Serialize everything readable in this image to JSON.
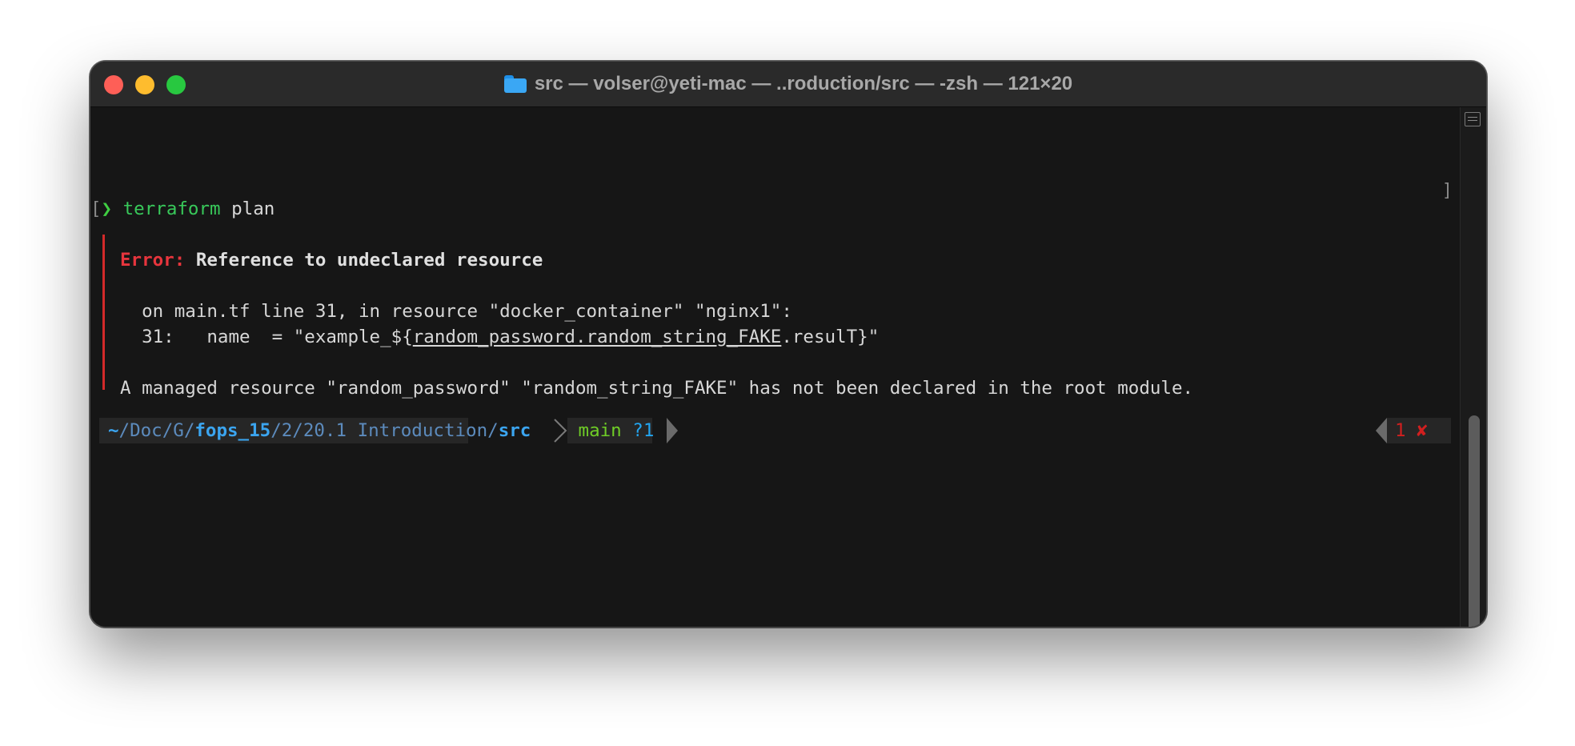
{
  "window": {
    "title": "src — volser@yeti-mac — ..roduction/src — -zsh — 121×20",
    "title_icon": "folder-icon"
  },
  "terminal": {
    "line1": {
      "bracket_left": "[",
      "prompt_char": "❯",
      "command": "terraform",
      "args": " plan",
      "bracket_right": "]"
    },
    "error": {
      "label": "Error:",
      "title": " Reference to undeclared resource",
      "location": "  on main.tf line 31, in resource \"docker_container\" \"nginx1\":",
      "code_prefix": "  31:   name  = \"example_${",
      "code_ref": "random_password.random_string_FAKE",
      "code_suffix": ".resulT}\"",
      "message": "A managed resource \"random_password\" \"random_string_FAKE\" has not been declared in the root module."
    },
    "prompt": {
      "path_dim_1": "~",
      "path_dim_2": "/Doc/G/",
      "path_bold_1": "fops_15",
      "path_dim_3": "/2/20.1 Introduction/",
      "path_bold_2": "src",
      "git_branch": "main",
      "git_status": "?1",
      "exit_code": "1",
      "exit_icon": "✘"
    }
  },
  "colors": {
    "background": "#161616",
    "error": "#e7353d",
    "command": "#38c95a",
    "path": "#3ba5f0",
    "git": "#6fcd26"
  }
}
